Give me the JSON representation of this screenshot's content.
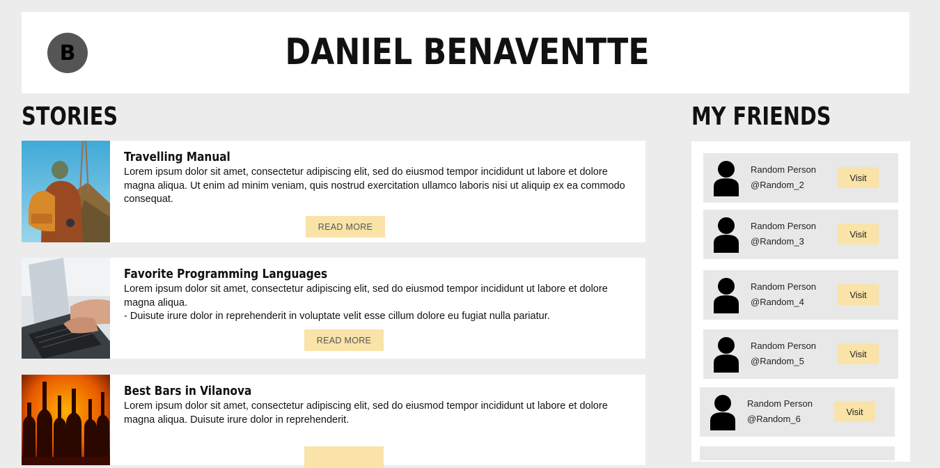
{
  "header": {
    "logo_letter": "B",
    "title": "DANIEL BENAVENTTE"
  },
  "stories": {
    "heading": "STORIES",
    "items": [
      {
        "title": "Travelling Manual",
        "text": "Lorem ipsum dolor sit amet, consectetur adipiscing elit, sed do eiusmod tempor incididunt ut labore et dolore magna aliqua. Ut enim ad minim veniam, quis nostrud exercitation ullamco laboris nisi ut aliquip ex ea commodo consequat.",
        "button": "READ MORE",
        "image": "hiker-photo"
      },
      {
        "title": "Favorite Programming Languages",
        "text": "Lorem ipsum dolor sit amet, consectetur adipiscing elit, sed do eiusmod tempor incididunt ut labore et dolore magna aliqua.\n- Duisute irure dolor in reprehenderit in voluptate velit esse cillum dolore eu fugiat nulla pariatur.",
        "button": "READ MORE",
        "image": "laptop-typing-photo"
      },
      {
        "title": "Best Bars in Vilanova",
        "text": "Lorem ipsum dolor sit amet, consectetur adipiscing elit, sed do eiusmod tempor incididunt ut labore et dolore magna aliqua. Duisute irure dolor in reprehenderit.",
        "button": "",
        "image": "bottles-photo"
      }
    ]
  },
  "friends": {
    "heading": "MY FRIENDS",
    "items": [
      {
        "name": "Random Person",
        "handle": "@Random_2",
        "button": "Visit"
      },
      {
        "name": "Random Person",
        "handle": "@Random_3",
        "button": "Visit"
      },
      {
        "name": "Random Person",
        "handle": "@Random_4",
        "button": "Visit"
      },
      {
        "name": "Random Person",
        "handle": "@Random_5",
        "button": "Visit"
      },
      {
        "name": "Random Person",
        "handle": "@Random_6",
        "button": "Visit"
      }
    ]
  },
  "colors": {
    "background": "#ececec",
    "card": "#ffffff",
    "button": "#f9e3a8",
    "friend_card": "#e8e8e8"
  }
}
